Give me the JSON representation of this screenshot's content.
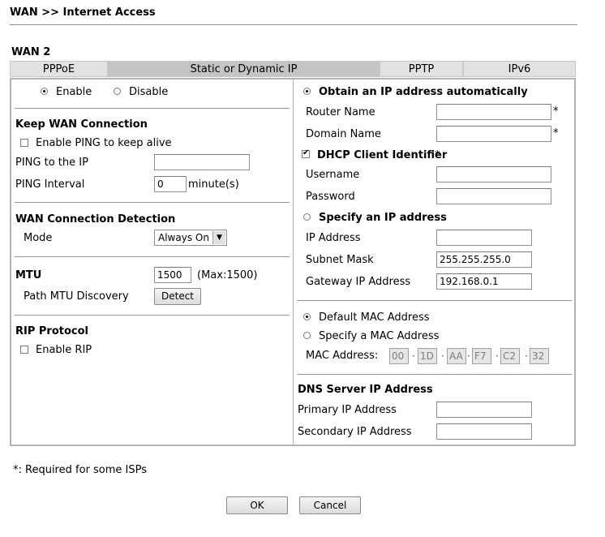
{
  "page": {
    "title": "WAN >> Internet Access"
  },
  "wan": {
    "label": "WAN 2"
  },
  "tabs": [
    {
      "label": "PPPoE"
    },
    {
      "label": "Static or Dynamic IP"
    },
    {
      "label": "PPTP"
    },
    {
      "label": "IPv6"
    }
  ],
  "left": {
    "enable_label": "Enable",
    "disable_label": "Disable",
    "keep_wan": {
      "heading": "Keep WAN Connection",
      "enable_ping_label": "Enable PING to keep alive",
      "ping_ip_label": "PING to the IP",
      "ping_ip_value": "",
      "ping_interval_label": "PING Interval",
      "ping_interval_value": "0",
      "ping_interval_unit": "minute(s)"
    },
    "detection": {
      "heading": "WAN Connection Detection",
      "mode_label": "Mode",
      "mode_value": "Always On"
    },
    "mtu": {
      "heading": "MTU",
      "value": "1500",
      "max_text": "(Max:1500)",
      "path_label": "Path MTU Discovery",
      "detect_label": "Detect"
    },
    "rip": {
      "heading": "RIP Protocol",
      "enable_label": "Enable RIP"
    }
  },
  "right": {
    "obtain_label": "Obtain an IP address automatically",
    "router_name_label": "Router Name",
    "router_name_value": "",
    "domain_name_label": "Domain Name",
    "domain_name_value": "",
    "required_star": "*",
    "dhcp_label": "DHCP Client Identifier",
    "username_label": "Username",
    "username_value": "",
    "password_label": "Password",
    "password_value": "",
    "specify_ip_label": "Specify an IP address",
    "ip_address_label": "IP Address",
    "ip_address_value": "",
    "subnet_label": "Subnet Mask",
    "subnet_value": "255.255.255.0",
    "gateway_label": "Gateway IP Address",
    "gateway_value": "192.168.0.1",
    "default_mac_label": "Default MAC Address",
    "specify_mac_label": "Specify a MAC Address",
    "mac_label": "MAC Address:",
    "mac_octets": [
      "00",
      "1D",
      "AA",
      "F7",
      "C2",
      "32"
    ],
    "dns": {
      "heading": "DNS Server IP Address",
      "primary_label": "Primary IP Address",
      "primary_value": "",
      "secondary_label": "Secondary IP Address",
      "secondary_value": ""
    }
  },
  "footer": {
    "note": "*: Required for some ISPs",
    "ok_label": "OK",
    "cancel_label": "Cancel"
  }
}
